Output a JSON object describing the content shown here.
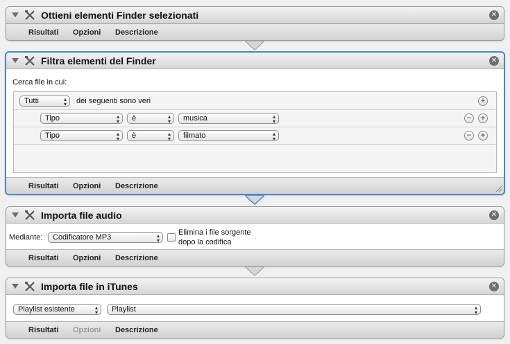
{
  "tabs": {
    "results": "Risultati",
    "options": "Opzioni",
    "description": "Descrizione"
  },
  "actions": [
    {
      "title": "Ottieni elementi Finder selezionati"
    },
    {
      "title": "Filtra elementi del Finder",
      "search_label": "Cerca file in cui:",
      "match_selector": "Tutti",
      "match_text": "dei seguenti sono veri",
      "rules": [
        {
          "field": "Tipo",
          "operator": "è",
          "value": "musica"
        },
        {
          "field": "Tipo",
          "operator": "è",
          "value": "filmato"
        }
      ]
    },
    {
      "title": "Importa file audio",
      "using_label": "Mediante:",
      "encoder": "Codificatore MP3",
      "delete_checkbox_line1": "Elimina i file sorgente",
      "delete_checkbox_line2": "dopo la codifica"
    },
    {
      "title": "Importa file in iTunes",
      "playlist_mode": "Playlist esistente",
      "playlist": "Playlist"
    }
  ],
  "colors": {
    "selected_border": "#4a86cf",
    "close_button": "#6e6e6e"
  }
}
